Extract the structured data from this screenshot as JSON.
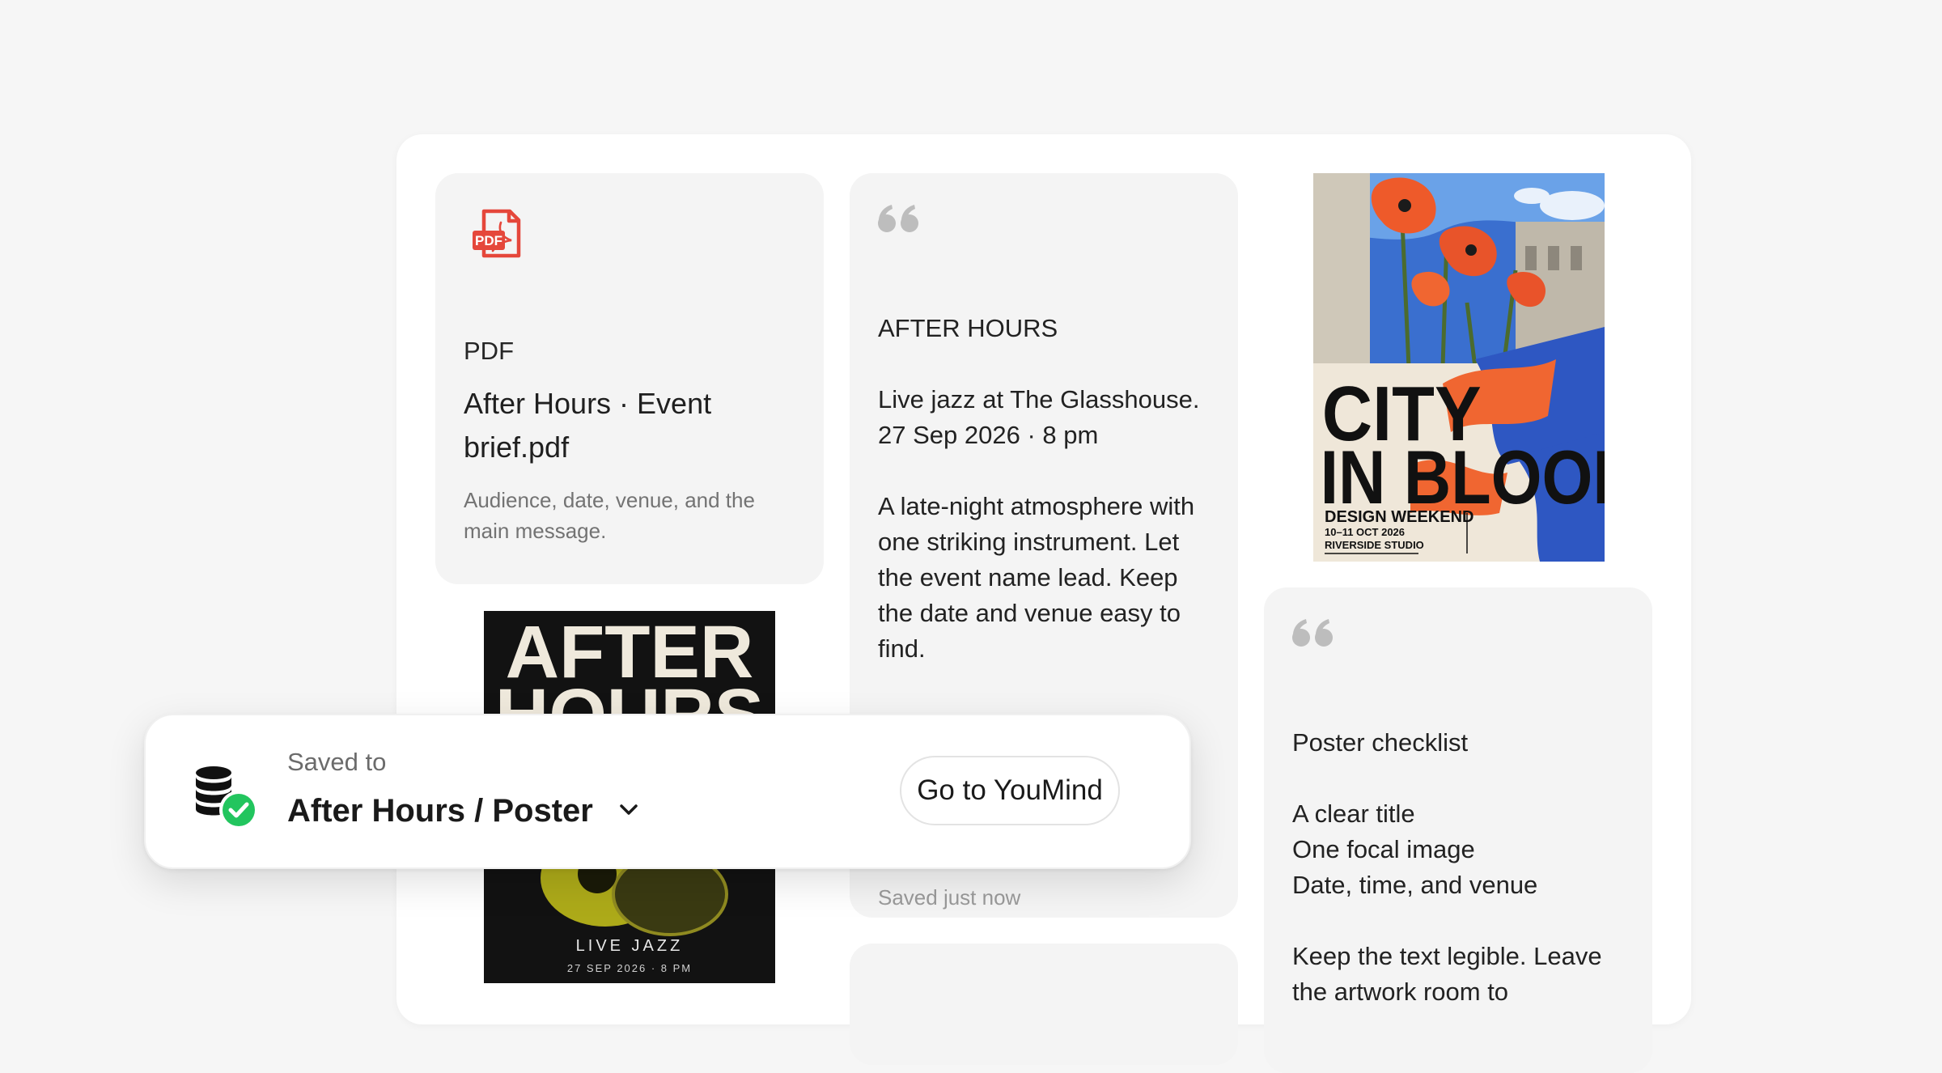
{
  "board": {
    "pdf_card": {
      "icon": "pdf-file-icon",
      "type_label": "PDF",
      "title": "After Hours · Event brief.pdf",
      "description": "Audience, date, venue, and the main message."
    },
    "note_card": {
      "icon": "quote-icon",
      "text": "AFTER HOURS\n\nLive jazz at The Glasshouse.\n27 Sep 2026 · 8 pm\n\nA late-night atmosphere with one striking instrument. Let the event name lead. Keep the date and venue easy to find.",
      "saved_status": "Saved just now"
    },
    "checklist_card": {
      "icon": "quote-icon",
      "text": "Poster checklist\n\nA clear title\nOne focal image\nDate, time, and venue\n\nKeep the text legible. Leave the artwork room to"
    },
    "poster_city_in_bloom": {
      "title_line1": "CITY",
      "title_line2": "IN BLOOM",
      "event": "DESIGN WEEKEND",
      "dates": "10–11 OCT 2026",
      "venue": "RIVERSIDE STUDIO"
    },
    "poster_after_hours": {
      "title_line1": "AFTER",
      "title_line2": "HOURS",
      "subtitle": "LIVE JAZZ",
      "date": "27 SEP 2026 · 8 PM"
    }
  },
  "toast": {
    "icon": "database-saved-icon",
    "saved_label": "Saved to",
    "destination": "After Hours / Poster",
    "dropdown_icon": "chevron-down-icon",
    "go_button_label": "Go to YouMind"
  },
  "colors": {
    "background": "#f6f6f6",
    "card": "#f4f4f4",
    "pdf_red": "#e5473b",
    "success_green": "#22c55e",
    "text": "#1e1e1e",
    "muted": "#737373"
  }
}
